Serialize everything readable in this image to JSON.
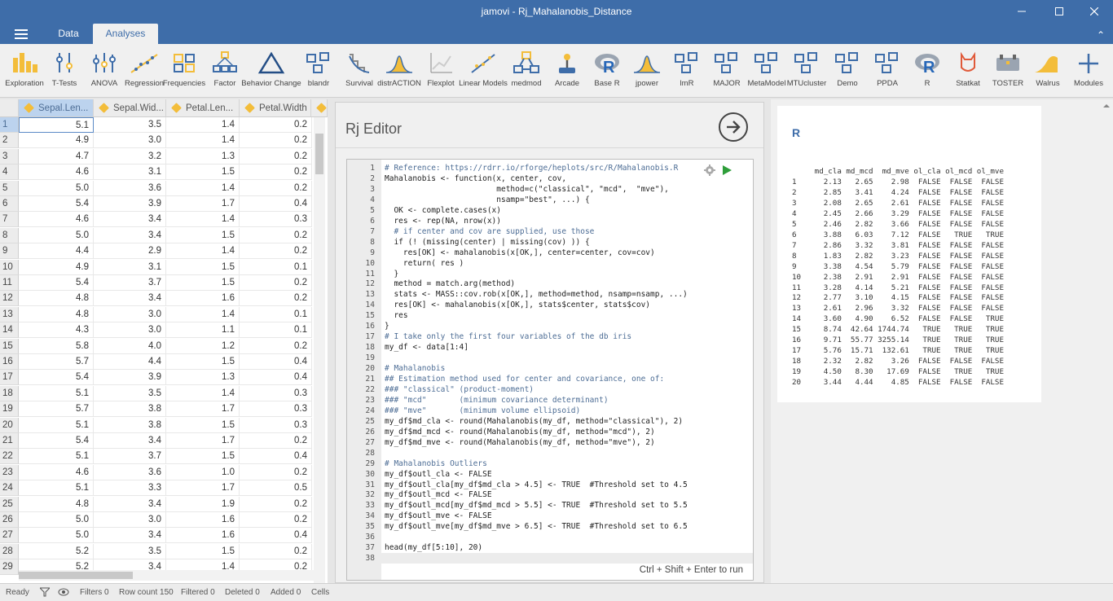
{
  "window": {
    "title": "jamovi - Rj_Mahalanobis_Distance"
  },
  "tabs": [
    {
      "label": "Data"
    },
    {
      "label": "Analyses"
    }
  ],
  "ribbon": [
    {
      "label": "Exploration",
      "icon": "exploration-icon"
    },
    {
      "label": "T-Tests",
      "icon": "t-tests-icon"
    },
    {
      "label": "ANOVA",
      "icon": "anova-icon"
    },
    {
      "label": "Regression",
      "icon": "regression-icon"
    },
    {
      "label": "Frequencies",
      "icon": "frequencies-icon"
    },
    {
      "label": "Factor",
      "icon": "factor-icon"
    },
    {
      "label": "Behavior Change",
      "icon": "behavior-change-icon"
    },
    {
      "label": "blandr",
      "icon": "module-icon"
    },
    {
      "label": "Survival",
      "icon": "survival-icon"
    },
    {
      "label": "distrACTION",
      "icon": "distribution-icon"
    },
    {
      "label": "Flexplot",
      "icon": "flexplot-icon"
    },
    {
      "label": "Linear Models",
      "icon": "linear-models-icon"
    },
    {
      "label": "medmod",
      "icon": "medmod-icon"
    },
    {
      "label": "Arcade",
      "icon": "joystick-icon"
    },
    {
      "label": "Base R",
      "icon": "r-logo-icon"
    },
    {
      "label": "jpower",
      "icon": "distribution-icon"
    },
    {
      "label": "lmR",
      "icon": "module-icon"
    },
    {
      "label": "MAJOR",
      "icon": "module-icon"
    },
    {
      "label": "MetaModel",
      "icon": "module-icon"
    },
    {
      "label": "MTUcluster",
      "icon": "module-icon"
    },
    {
      "label": "Demo",
      "icon": "module-icon"
    },
    {
      "label": "PPDA",
      "icon": "module-icon"
    },
    {
      "label": "R",
      "icon": "r-logo-icon"
    },
    {
      "label": "Statkat",
      "icon": "statkat-icon"
    },
    {
      "label": "TOSTER",
      "icon": "toster-icon"
    },
    {
      "label": "Walrus",
      "icon": "walrus-icon"
    },
    {
      "label": "Modules",
      "icon": "plus-icon"
    }
  ],
  "sheet": {
    "columns": [
      "Sepal.Len...",
      "Sepal.Wid...",
      "Petal.Len...",
      "Petal.Width"
    ],
    "rows": [
      [
        "5.1",
        "3.5",
        "1.4",
        "0.2"
      ],
      [
        "4.9",
        "3.0",
        "1.4",
        "0.2"
      ],
      [
        "4.7",
        "3.2",
        "1.3",
        "0.2"
      ],
      [
        "4.6",
        "3.1",
        "1.5",
        "0.2"
      ],
      [
        "5.0",
        "3.6",
        "1.4",
        "0.2"
      ],
      [
        "5.4",
        "3.9",
        "1.7",
        "0.4"
      ],
      [
        "4.6",
        "3.4",
        "1.4",
        "0.3"
      ],
      [
        "5.0",
        "3.4",
        "1.5",
        "0.2"
      ],
      [
        "4.4",
        "2.9",
        "1.4",
        "0.2"
      ],
      [
        "4.9",
        "3.1",
        "1.5",
        "0.1"
      ],
      [
        "5.4",
        "3.7",
        "1.5",
        "0.2"
      ],
      [
        "4.8",
        "3.4",
        "1.6",
        "0.2"
      ],
      [
        "4.8",
        "3.0",
        "1.4",
        "0.1"
      ],
      [
        "4.3",
        "3.0",
        "1.1",
        "0.1"
      ],
      [
        "5.8",
        "4.0",
        "1.2",
        "0.2"
      ],
      [
        "5.7",
        "4.4",
        "1.5",
        "0.4"
      ],
      [
        "5.4",
        "3.9",
        "1.3",
        "0.4"
      ],
      [
        "5.1",
        "3.5",
        "1.4",
        "0.3"
      ],
      [
        "5.7",
        "3.8",
        "1.7",
        "0.3"
      ],
      [
        "5.1",
        "3.8",
        "1.5",
        "0.3"
      ],
      [
        "5.4",
        "3.4",
        "1.7",
        "0.2"
      ],
      [
        "5.1",
        "3.7",
        "1.5",
        "0.4"
      ],
      [
        "4.6",
        "3.6",
        "1.0",
        "0.2"
      ],
      [
        "5.1",
        "3.3",
        "1.7",
        "0.5"
      ],
      [
        "4.8",
        "3.4",
        "1.9",
        "0.2"
      ],
      [
        "5.0",
        "3.0",
        "1.6",
        "0.2"
      ],
      [
        "5.0",
        "3.4",
        "1.6",
        "0.4"
      ],
      [
        "5.2",
        "3.5",
        "1.5",
        "0.2"
      ],
      [
        "5.2",
        "3.4",
        "1.4",
        "0.2"
      ]
    ]
  },
  "status": {
    "ready": "Ready",
    "filters": "Filters 0",
    "row_count": "Row count 150",
    "filtered": "Filtered 0",
    "deleted": "Deleted 0",
    "added": "Added 0",
    "cells": "Cells"
  },
  "editor": {
    "title": "Rj Editor",
    "hint": "Ctrl + Shift + Enter to run",
    "lines": [
      "# Reference: https://rdrr.io/rforge/heplots/src/R/Mahalanobis.R",
      "Mahalanobis <- function(x, center, cov,",
      "                        method=c(\"classical\", \"mcd\",  \"mve\"),",
      "                        nsamp=\"best\", ...) {",
      "  OK <- complete.cases(x)",
      "  res <- rep(NA, nrow(x))",
      "  # if center and cov are supplied, use those",
      "  if (! (missing(center) | missing(cov) )) {",
      "    res[OK] <- mahalanobis(x[OK,], center=center, cov=cov)",
      "    return( res )",
      "  }",
      "  method = match.arg(method)",
      "  stats <- MASS::cov.rob(x[OK,], method=method, nsamp=nsamp, ...)",
      "  res[OK] <- mahalanobis(x[OK,], stats$center, stats$cov)",
      "  res",
      "}",
      "# I take only the first four variables of the db iris",
      "my_df <- data[1:4]",
      "",
      "# Mahalanobis",
      "## Estimation method used for center and covariance, one of:",
      "### \"classical\" (product-moment)",
      "### \"mcd\"       (minimum covariance determinant)",
      "### \"mve\"       (minimum volume ellipsoid)",
      "my_df$md_cla <- round(Mahalanobis(my_df, method=\"classical\"), 2)",
      "my_df$md_mcd <- round(Mahalanobis(my_df, method=\"mcd\"), 2)",
      "my_df$md_mve <- round(Mahalanobis(my_df, method=\"mve\"), 2)",
      "",
      "# Mahalanobis Outliers",
      "my_df$outl_cla <- FALSE",
      "my_df$outl_cla[my_df$md_cla > 4.5] <- TRUE  #Threshold set to 4.5",
      "my_df$outl_mcd <- FALSE",
      "my_df$outl_mcd[my_df$md_mcd > 5.5] <- TRUE  #Threshold set to 5.5",
      "my_df$outl_mve <- FALSE",
      "my_df$outl_mve[my_df$md_mve > 6.5] <- TRUE  #Threshold set to 6.5",
      "",
      "head(my_df[5:10], 20)",
      ""
    ]
  },
  "results": {
    "title": "R",
    "header": "     md_cla md_mcd  md_mve ol_cla ol_mcd ol_mve",
    "rows": [
      "1      2.13   2.65    2.98  FALSE  FALSE  FALSE",
      "2      2.85   3.41    4.24  FALSE  FALSE  FALSE",
      "3      2.08   2.65    2.61  FALSE  FALSE  FALSE",
      "4      2.45   2.66    3.29  FALSE  FALSE  FALSE",
      "5      2.46   2.82    3.66  FALSE  FALSE  FALSE",
      "6      3.88   6.03    7.12  FALSE   TRUE   TRUE",
      "7      2.86   3.32    3.81  FALSE  FALSE  FALSE",
      "8      1.83   2.82    3.23  FALSE  FALSE  FALSE",
      "9      3.38   4.54    5.79  FALSE  FALSE  FALSE",
      "10     2.38   2.91    2.91  FALSE  FALSE  FALSE",
      "11     3.28   4.14    5.21  FALSE  FALSE  FALSE",
      "12     2.77   3.10    4.15  FALSE  FALSE  FALSE",
      "13     2.61   2.96    3.32  FALSE  FALSE  FALSE",
      "14     3.60   4.90    6.52  FALSE  FALSE   TRUE",
      "15     8.74  42.64 1744.74   TRUE   TRUE   TRUE",
      "16     9.71  55.77 3255.14   TRUE   TRUE   TRUE",
      "17     5.76  15.71  132.61   TRUE   TRUE   TRUE",
      "18     2.32   2.82    3.26  FALSE  FALSE  FALSE",
      "19     4.50   8.30   17.69  FALSE   TRUE   TRUE",
      "20     3.44   4.44    4.85  FALSE  FALSE  FALSE"
    ]
  },
  "colors": {
    "brand": "#3e6da9",
    "accent": "#f3bd3a",
    "run": "#2e9e3a"
  }
}
